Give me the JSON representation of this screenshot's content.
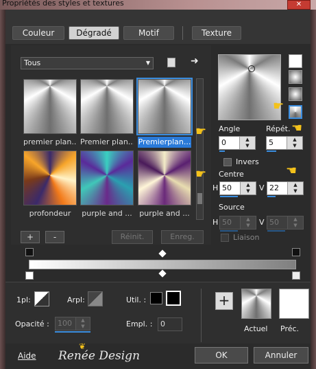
{
  "window": {
    "title": "Propriétés des styles et textures",
    "close_icon": "close-icon"
  },
  "tabs": [
    {
      "label": "Couleur"
    },
    {
      "label": "Dégradé",
      "selected": true
    },
    {
      "label": "Motif"
    },
    {
      "label": "Texture"
    }
  ],
  "filter": {
    "value": "Tous"
  },
  "presets": [
    {
      "label": "premier plan...",
      "style": "silver-conical"
    },
    {
      "label": "Premier plan...",
      "style": "silver-conical"
    },
    {
      "label": "Premierplan...",
      "style": "silver-conical",
      "selected": true
    },
    {
      "label": "profondeur",
      "style": "orange-purple"
    },
    {
      "label": "purple and ...",
      "style": "teal-purple"
    },
    {
      "label": "purple and ...",
      "style": "cream-purple"
    }
  ],
  "list_buttons": {
    "add": "+",
    "remove": "-",
    "reset": "Réinit.",
    "save": "Enreg."
  },
  "style_options": {
    "angle_label": "Angle",
    "angle_value": "0",
    "repeat_label": "Répét.",
    "repeat_value": "5",
    "invert_label": "Invers",
    "center_label": "Centre",
    "center_h_label": "H",
    "center_h": "50",
    "center_v_label": "V",
    "center_v": "22",
    "source_label": "Source",
    "source_h_label": "H",
    "source_h": "50",
    "source_v_label": "V",
    "source_v": "50",
    "link_label": "Liaison"
  },
  "bottom": {
    "first_label": "1pl:",
    "arpl_label": "Arpl:",
    "util_label": "Util. :",
    "opacity_label": "Opacité :",
    "opacity_value": "100",
    "empl_label": "Empl. :",
    "empl_value": "0",
    "current_label": "Actuel",
    "previous_label": "Préc.",
    "help_label": "Aide",
    "watermark": "Renée Design",
    "ok_label": "OK",
    "cancel_label": "Annuler"
  },
  "colors": {
    "accent": "#3b8ee0",
    "pointer": "#f4c21b"
  }
}
